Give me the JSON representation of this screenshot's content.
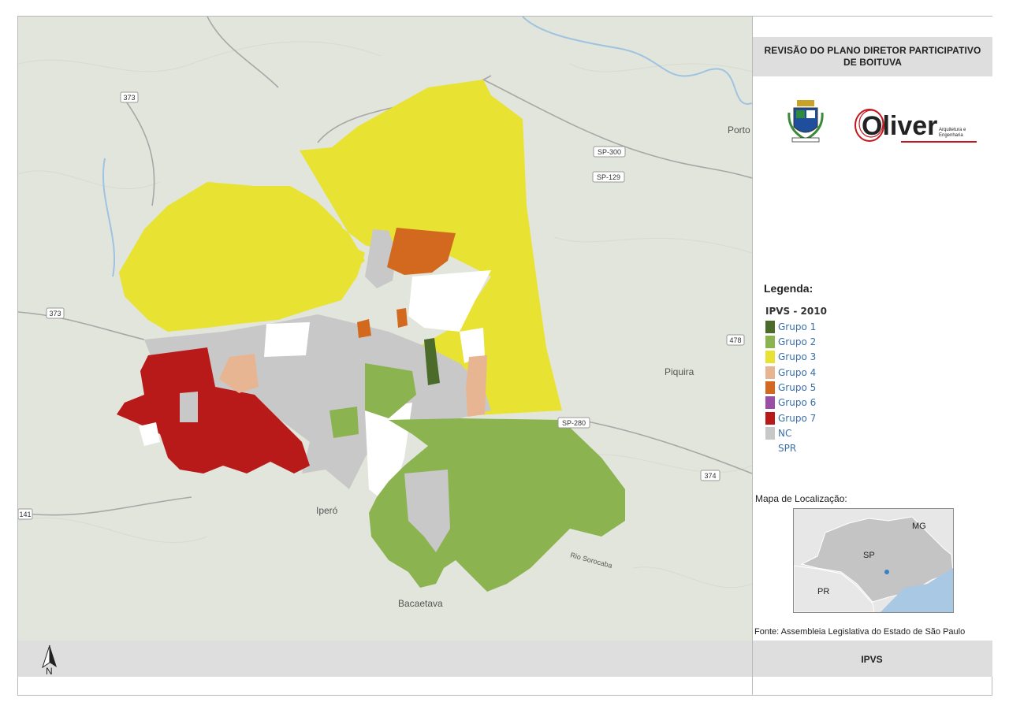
{
  "header": {
    "title_line1": "REVISÃO DO PLANO DIRETOR PARTICIPATIVO",
    "title_line2": "DE BOITUVA"
  },
  "logo": {
    "brand": "Oliver",
    "tagline_line1": "Arquitetura e",
    "tagline_line2": "Engenharia"
  },
  "legend": {
    "title": "Legenda:",
    "subtitle": "IPVS - 2010",
    "items": [
      {
        "label": "Grupo 1",
        "color": "#4a6b2a"
      },
      {
        "label": "Grupo 2",
        "color": "#8bb34f"
      },
      {
        "label": "Grupo 3",
        "color": "#e8e233"
      },
      {
        "label": "Grupo 4",
        "color": "#e8b593"
      },
      {
        "label": "Grupo 5",
        "color": "#d2691e"
      },
      {
        "label": "Grupo 6",
        "color": "#9b4ea6"
      },
      {
        "label": "Grupo 7",
        "color": "#b81a1a"
      },
      {
        "label": "NC",
        "color": "#c8c8c8"
      },
      {
        "label": "SPR",
        "color": "#ffffff"
      }
    ]
  },
  "location_map": {
    "title": "Mapa de Localização:",
    "labels": {
      "mg": "MG",
      "sp": "SP",
      "pr": "PR"
    }
  },
  "source": "Fonte: Assembleia Legislativa do Estado de São Paulo",
  "footer": {
    "label": "IPVS",
    "north": "N"
  },
  "map_labels": {
    "porto": "Porto",
    "piquira": "Piquira",
    "ipero": "Iperó",
    "bacaetava": "Bacaetava",
    "rio_sorocaba": "Rio Sorocaba",
    "road_373a": "373",
    "road_373b": "373",
    "road_sp300": "SP-300",
    "road_sp129": "SP-129",
    "road_478": "478",
    "road_sp280": "SP-280",
    "road_374": "374",
    "road_141": "141"
  }
}
